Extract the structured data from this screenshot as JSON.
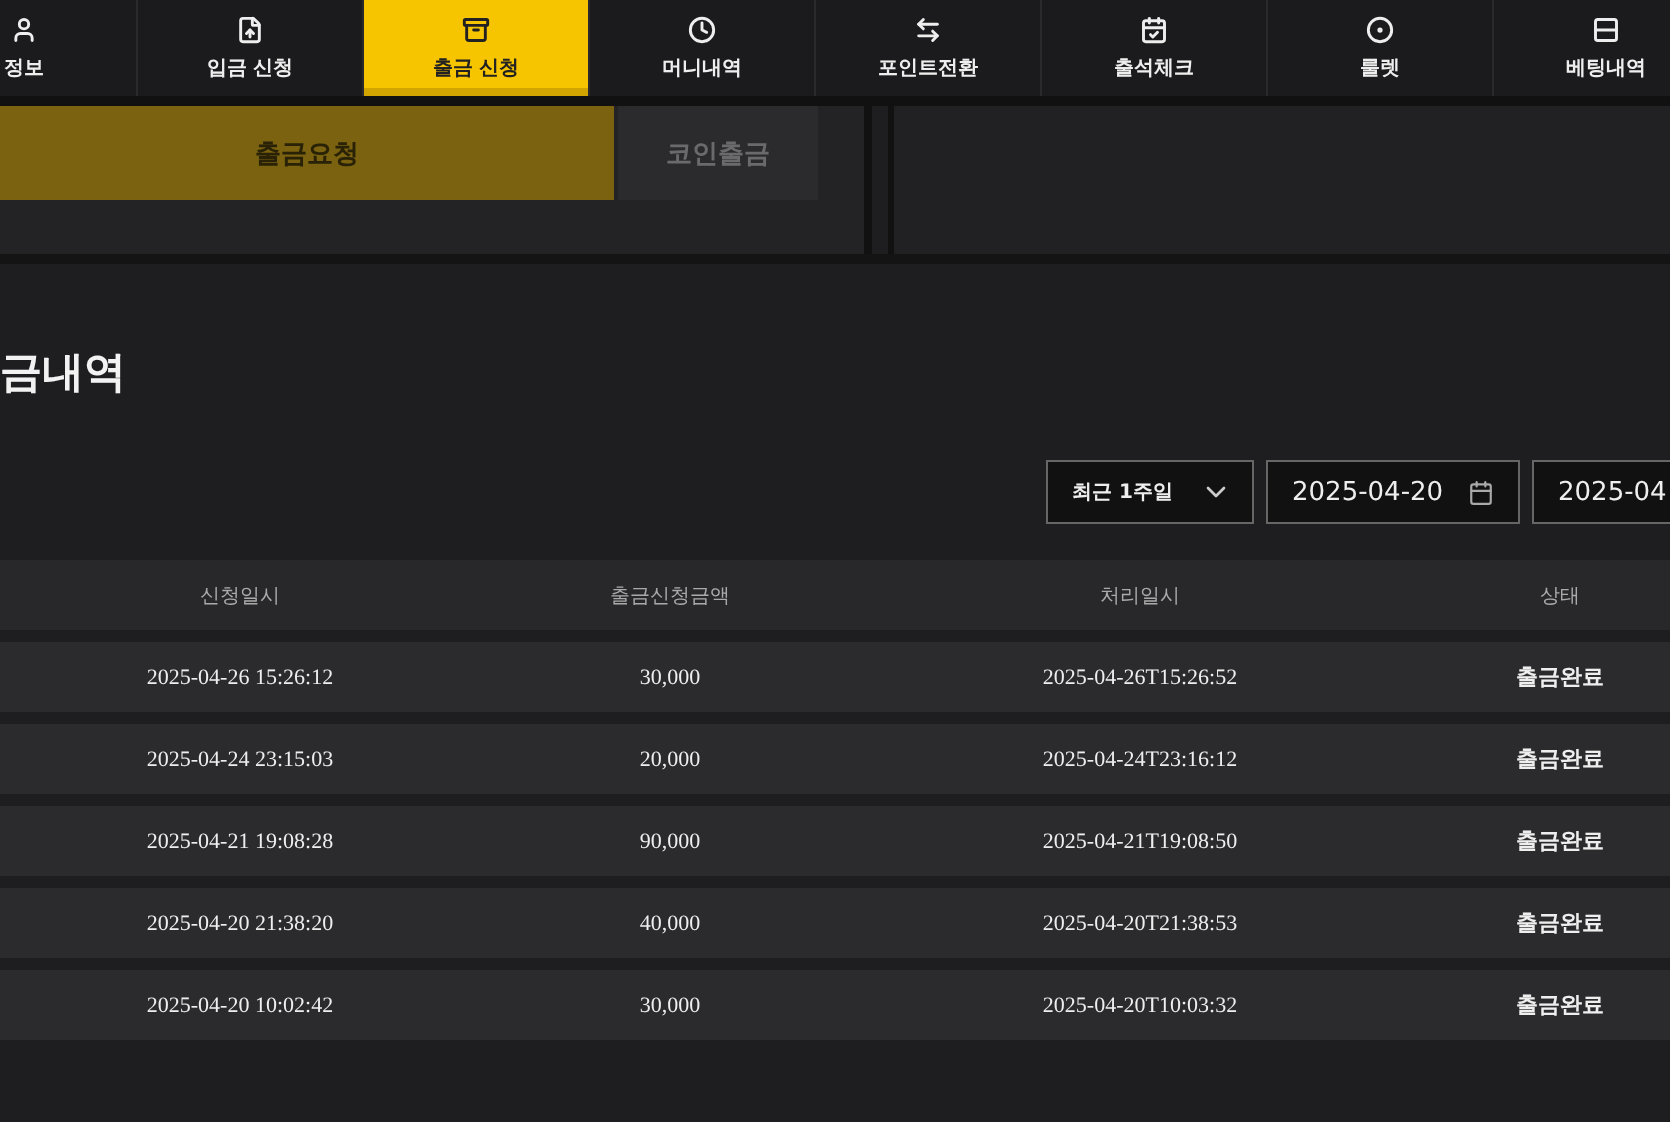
{
  "nav_tabs": [
    {
      "label": "정보",
      "selected": false
    },
    {
      "label": "입금 신청",
      "selected": false
    },
    {
      "label": "출금 신청",
      "selected": true
    },
    {
      "label": "머니내역",
      "selected": false
    },
    {
      "label": "포인트전환",
      "selected": false
    },
    {
      "label": "출석체크",
      "selected": false
    },
    {
      "label": "룰렛",
      "selected": false
    },
    {
      "label": "베팅내역",
      "selected": false
    }
  ],
  "withdraw_tabs": [
    {
      "label": "출금요청",
      "selected": true
    },
    {
      "label": "코인출금",
      "selected": false
    }
  ],
  "section_title": "금내역",
  "filter": {
    "period": "최근 1주일",
    "date_from": "2025-04-20",
    "date_to": "2025-04"
  },
  "table": {
    "columns": [
      "신청일시",
      "출금신청금액",
      "처리일시",
      "상태"
    ],
    "rows": [
      [
        "2025-04-26 15:26:12",
        "30,000",
        "2025-04-26T15:26:52",
        "출금완료"
      ],
      [
        "2025-04-24 23:15:03",
        "20,000",
        "2025-04-24T23:16:12",
        "출금완료"
      ],
      [
        "2025-04-21 19:08:28",
        "90,000",
        "2025-04-21T19:08:50",
        "출금완료"
      ],
      [
        "2025-04-20 21:38:20",
        "40,000",
        "2025-04-20T21:38:53",
        "출금완료"
      ],
      [
        "2025-04-20 10:02:42",
        "30,000",
        "2025-04-20T10:03:32",
        "출금완료"
      ]
    ]
  }
}
